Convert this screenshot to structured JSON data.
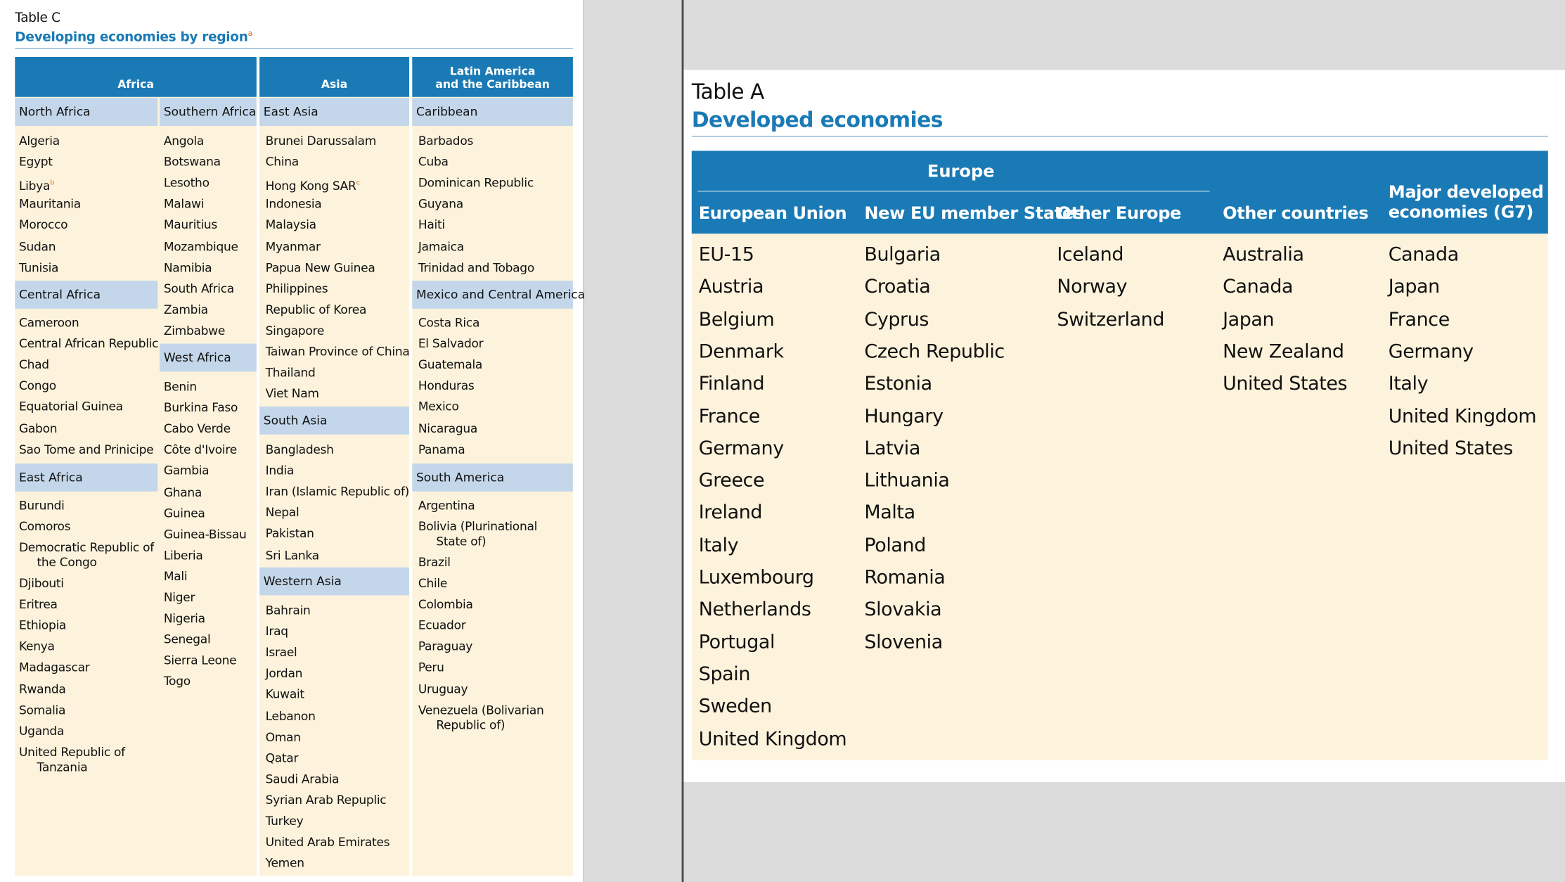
{
  "table_c": {
    "label": "Table C",
    "title": "Developing economies by region",
    "title_sup": "a",
    "col_africa": "Africa",
    "col_asia": "Asia",
    "col_latam_line1": "Latin America",
    "col_latam_line2": "and the Caribbean",
    "north_africa": {
      "label": "North Africa",
      "items": [
        "Algeria",
        "Egypt",
        "Libya",
        "Mauritania",
        "Morocco",
        "Sudan",
        "Tunisia"
      ],
      "libya_sup": "b"
    },
    "central_africa": {
      "label": "Central Africa",
      "items": [
        "Cameroon",
        "Central African Republic",
        "Chad",
        "Congo",
        "Equatorial Guinea",
        "Gabon",
        "Sao Tome and Prinicipe"
      ]
    },
    "east_africa": {
      "label": "East Africa",
      "items": [
        "Burundi",
        "Comoros",
        "Democratic Republic of the Congo",
        "Djibouti",
        "Eritrea",
        "Ethiopia",
        "Kenya",
        "Madagascar",
        "Rwanda",
        "Somalia",
        "Uganda",
        "United Republic of Tanzania"
      ]
    },
    "southern_africa": {
      "label": "Southern Africa",
      "items": [
        "Angola",
        "Botswana",
        "Lesotho",
        "Malawi",
        "Mauritius",
        "Mozambique",
        "Namibia",
        "South Africa",
        "Zambia",
        "Zimbabwe"
      ]
    },
    "west_africa": {
      "label": "West Africa",
      "items": [
        "Benin",
        "Burkina Faso",
        "Cabo Verde",
        "Côte d'Ivoire",
        "Gambia",
        "Ghana",
        "Guinea",
        "Guinea-Bissau",
        "Liberia",
        "Mali",
        "Niger",
        "Nigeria",
        "Senegal",
        "Sierra Leone",
        "Togo"
      ]
    },
    "east_asia": {
      "label": "East Asia",
      "items": [
        "Brunei Darussalam",
        "China",
        "Hong Kong SAR",
        "Indonesia",
        "Malaysia",
        "Myanmar",
        "Papua New Guinea",
        "Philippines",
        "Republic of Korea",
        "Singapore",
        "Taiwan Province of China",
        "Thailand",
        "Viet Nam"
      ],
      "hk_sup": "c"
    },
    "south_asia": {
      "label": "South Asia",
      "items": [
        "Bangladesh",
        "India",
        "Iran (Islamic Republic of)",
        "Nepal",
        "Pakistan",
        "Sri Lanka"
      ]
    },
    "western_asia": {
      "label": "Western Asia",
      "items": [
        "Bahrain",
        "Iraq",
        "Israel",
        "Jordan",
        "Kuwait",
        "Lebanon",
        "Oman",
        "Qatar",
        "Saudi Arabia",
        "Syrian Arab Repuplic",
        "Turkey",
        "United Arab Emirates",
        "Yemen"
      ]
    },
    "caribbean": {
      "label": "Caribbean",
      "items": [
        "Barbados",
        "Cuba",
        "Dominican Republic",
        "Guyana",
        "Haiti",
        "Jamaica",
        "Trinidad and Tobago"
      ]
    },
    "mexico_central": {
      "label": "Mexico and Central America",
      "items": [
        "Costa Rica",
        "El Salvador",
        "Guatemala",
        "Honduras",
        "Mexico",
        "Nicaragua",
        "Panama"
      ]
    },
    "south_america": {
      "label": "South America",
      "items": [
        "Argentina",
        "Bolivia (Plurinational State of)",
        "Brazil",
        "Chile",
        "Colombia",
        "Ecuador",
        "Paraguay",
        "Peru",
        "Uruguay",
        "Venezuela (Bolivarian Republic of)"
      ]
    }
  },
  "table_a": {
    "label": "Table A",
    "title": "Developed economies",
    "europe": "Europe",
    "headers": {
      "eu": "European Union",
      "new_eu": "New EU member States",
      "other_europe": "Other Europe",
      "other_countries": "Other countries",
      "g7_line1": "Major developed",
      "g7_line2": "economies (G7)"
    },
    "eu": [
      "EU-15",
      "Austria",
      "Belgium",
      "Denmark",
      "Finland",
      "France",
      "Germany",
      "Greece",
      "Ireland",
      "Italy",
      "Luxembourg",
      "Netherlands",
      "Portugal",
      "Spain",
      "Sweden",
      "United Kingdom"
    ],
    "new_eu": [
      "Bulgaria",
      "Croatia",
      "Cyprus",
      "Czech Republic",
      "Estonia",
      "Hungary",
      "Latvia",
      "Lithuania",
      "Malta",
      "Poland",
      "Romania",
      "Slovakia",
      "Slovenia"
    ],
    "other_europe": [
      "Iceland",
      "Norway",
      "Switzerland"
    ],
    "other_countries": [
      "Australia",
      "Canada",
      "Japan",
      "New Zealand",
      "United States"
    ],
    "g7": [
      "Canada",
      "Japan",
      "France",
      "Germany",
      "Italy",
      "United Kingdom",
      "United States"
    ]
  }
}
